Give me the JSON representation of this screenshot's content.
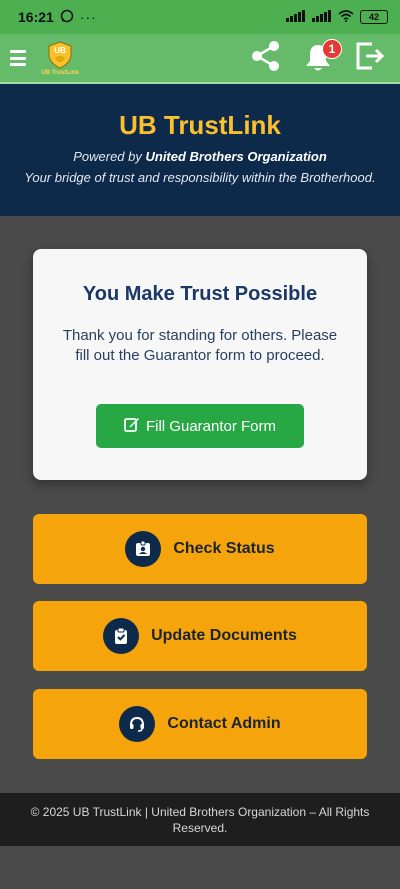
{
  "status_bar": {
    "time": "16:21",
    "dots": "···",
    "battery": "42"
  },
  "app_bar": {
    "logo_initials": "UB",
    "logo_text": "UB TrustLink",
    "notification_count": "1"
  },
  "hero": {
    "title": "UB TrustLink",
    "powered_prefix": "Powered by ",
    "powered_org": "United Brothers Organization",
    "tagline": "Your bridge of trust and responsibility within the Brotherhood."
  },
  "card": {
    "title": "You Make Trust Possible",
    "body": "Thank you for standing for others. Please fill out the Guarantor form to proceed.",
    "button_label": "Fill Guarantor Form"
  },
  "actions": [
    {
      "label": "Check Status",
      "icon": "id-badge-icon"
    },
    {
      "label": "Update Documents",
      "icon": "clipboard-check-icon"
    },
    {
      "label": "Contact Admin",
      "icon": "headset-icon"
    }
  ],
  "footer": {
    "text": "© 2025 UB TrustLink | United Brothers Organization – All Rights Reserved."
  },
  "colors": {
    "status_bar": "#4caf50",
    "app_bar": "#66bb6a",
    "hero_bg": "#0d2a4a",
    "hero_title": "#fbc02d",
    "primary_button": "#28a745",
    "action_button": "#f5a40c",
    "footer_bg": "#1e1e1e"
  }
}
